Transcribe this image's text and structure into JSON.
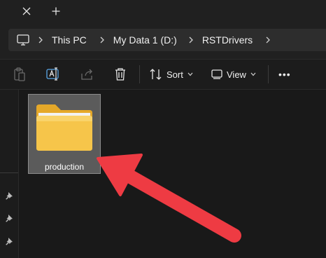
{
  "tabstrip": {
    "close_icon": "close-icon",
    "new_tab_icon": "plus-icon"
  },
  "address": {
    "root_icon": "computer-icon",
    "crumbs": [
      "This PC",
      "My Data 1 (D:)",
      "RSTDrivers"
    ]
  },
  "toolbar": {
    "sort_label": "Sort",
    "view_label": "View",
    "more_label": "•••"
  },
  "content": {
    "items": [
      {
        "name": "production",
        "type": "folder",
        "selected": true
      }
    ]
  },
  "colors": {
    "accent_arrow": "#ee3b43",
    "folder": "#f6c54a"
  }
}
